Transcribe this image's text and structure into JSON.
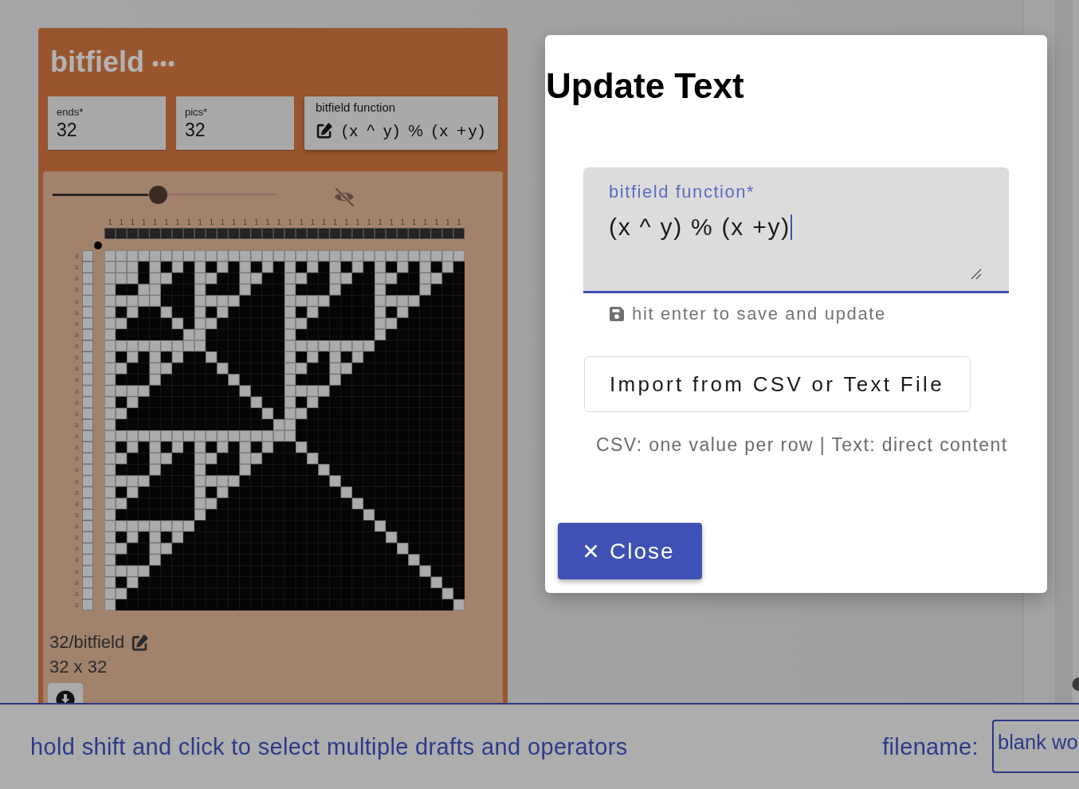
{
  "card": {
    "title": "bitfield",
    "fields": [
      {
        "label": "ends*",
        "value": "32"
      },
      {
        "label": "pics*",
        "value": "32"
      }
    ],
    "function_button": {
      "label": "bitfield function",
      "value": "(x ^ y) % (x +y)"
    },
    "zoom_slider": {
      "level": 0.47
    },
    "draft": {
      "warp_labels": [
        "1",
        "1",
        "1",
        "1",
        "1",
        "1",
        "1",
        "1",
        "1",
        "1",
        "1",
        "1",
        "1",
        "1",
        "1",
        "1",
        "1",
        "1",
        "1",
        "1",
        "1",
        "1",
        "1",
        "1",
        "1",
        "1",
        "1",
        "1",
        "1",
        "1",
        "1",
        "1"
      ],
      "weft_labels": [
        "a",
        "a",
        "a",
        "a",
        "a",
        "a",
        "a",
        "a",
        "a",
        "a",
        "a",
        "a",
        "a",
        "a",
        "a",
        "a",
        "a",
        "a",
        "a",
        "a",
        "a",
        "a",
        "a",
        "a",
        "a",
        "a",
        "a",
        "a",
        "a",
        "a",
        "a",
        "a"
      ]
    },
    "name": "32/bitfield",
    "size": "32 x 32"
  },
  "modal": {
    "title": "Update Text",
    "field": {
      "label": "bitfield function*",
      "value": "(x ^ y) % (x +y)",
      "focused": true
    },
    "hint": "hit enter to save and update",
    "import_button": "Import from CSV or Text File",
    "import_note": "CSV: one value per row | Text: direct content",
    "close_button": "Close"
  },
  "status_bar": {
    "message": "hold shift and click to select multiple drafts and operators",
    "filename_label": "filename:",
    "filename_value": "blank wo"
  }
}
